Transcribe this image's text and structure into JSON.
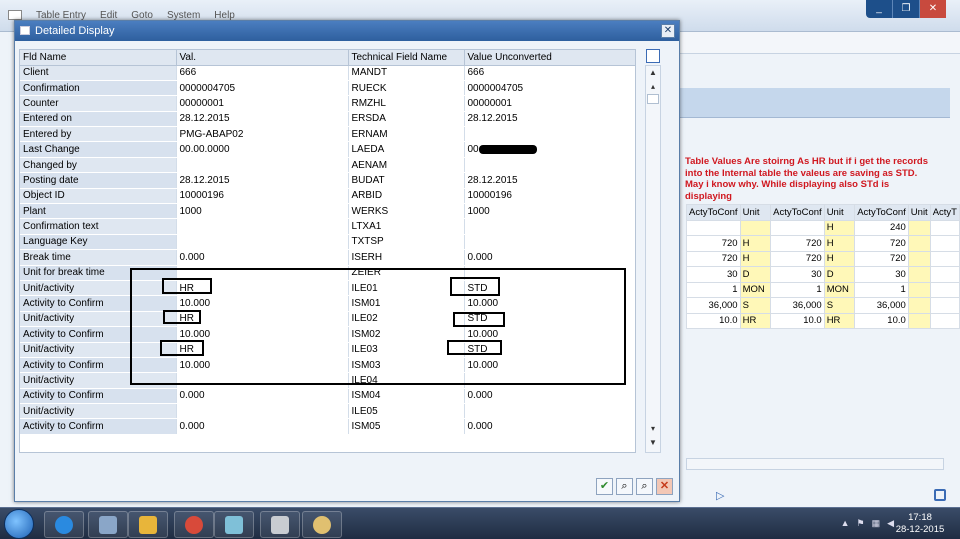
{
  "menubar": {
    "items": [
      "Table Entry",
      "Edit",
      "Goto",
      "System",
      "Help"
    ]
  },
  "window_controls": [
    "_",
    "❐",
    "✕"
  ],
  "dialog": {
    "title": "Detailed Display",
    "close_label": "✕",
    "columns": [
      "Fld Name",
      "Val.",
      "Technical Field Name",
      "Value Unconverted"
    ],
    "rows": [
      {
        "name": "Client",
        "val": "666",
        "tech": "MANDT",
        "unc": "666"
      },
      {
        "name": "Confirmation",
        "val": "0000004705",
        "tech": "RUECK",
        "unc": "0000004705"
      },
      {
        "name": "Counter",
        "val": "00000001",
        "tech": "RMZHL",
        "unc": "00000001"
      },
      {
        "name": "Entered on",
        "val": "28.12.2015",
        "tech": "ERSDA",
        "unc": "28.12.2015"
      },
      {
        "name": "Entered by",
        "val": "PMG-ABAP02",
        "tech": "ERNAM",
        "unc": ""
      },
      {
        "name": "Last Change",
        "val": "00.00.0000",
        "tech": "LAEDA",
        "unc": "00.00.0000"
      },
      {
        "name": "Changed by",
        "val": "",
        "tech": "AENAM",
        "unc": ""
      },
      {
        "name": "Posting date",
        "val": "28.12.2015",
        "tech": "BUDAT",
        "unc": "28.12.2015"
      },
      {
        "name": "Object ID",
        "val": "10000196",
        "tech": "ARBID",
        "unc": "10000196"
      },
      {
        "name": "Plant",
        "val": "1000",
        "tech": "WERKS",
        "unc": "1000"
      },
      {
        "name": "Confirmation text",
        "val": "",
        "tech": "LTXA1",
        "unc": ""
      },
      {
        "name": "Language Key",
        "val": "",
        "tech": "TXTSP",
        "unc": ""
      },
      {
        "name": "Break time",
        "val": "0.000",
        "tech": "ISERH",
        "unc": "0.000"
      },
      {
        "name": "Unit for break time",
        "val": "",
        "tech": "ZEIER",
        "unc": ""
      },
      {
        "name": "Unit/activity",
        "val": "HR",
        "tech": "ILE01",
        "unc": "STD"
      },
      {
        "name": "Activity to Confirm",
        "val": "10.000",
        "tech": "ISM01",
        "unc": "10.000"
      },
      {
        "name": "Unit/activity",
        "val": "HR",
        "tech": "ILE02",
        "unc": "STD"
      },
      {
        "name": "Activity to Confirm",
        "val": "10.000",
        "tech": "ISM02",
        "unc": "10.000"
      },
      {
        "name": "Unit/activity",
        "val": "HR",
        "tech": "ILE03",
        "unc": "STD"
      },
      {
        "name": "Activity to Confirm",
        "val": "10.000",
        "tech": "ISM03",
        "unc": "10.000"
      },
      {
        "name": "Unit/activity",
        "val": "",
        "tech": "ILE04",
        "unc": ""
      },
      {
        "name": "Activity to Confirm",
        "val": "0.000",
        "tech": "ISM04",
        "unc": "0.000"
      },
      {
        "name": "Unit/activity",
        "val": "",
        "tech": "ILE05",
        "unc": ""
      },
      {
        "name": "Activity to Confirm",
        "val": "0.000",
        "tech": "ISM05",
        "unc": "0.000"
      }
    ]
  },
  "annotation_text": "Table Values Are stoirng As HR but if i get the records into the Internal table the valeus are saving as STD. May i know why. While displaying also STd is displaying",
  "alv": {
    "headers": [
      "ActyToConf",
      "Unit",
      "ActyToConf",
      "Unit",
      "ActyToConf",
      "Unit",
      "ActyT"
    ],
    "rows": [
      [
        "",
        "",
        "",
        "H",
        "240",
        "",
        ""
      ],
      [
        "720",
        "H",
        "720",
        "H",
        "720",
        "",
        ""
      ],
      [
        "720",
        "H",
        "720",
        "H",
        "720",
        "",
        ""
      ],
      [
        "30",
        "D",
        "30",
        "D",
        "30",
        "",
        ""
      ],
      [
        "1",
        "MON",
        "1",
        "MON",
        "1",
        "",
        ""
      ],
      [
        "36,000",
        "S",
        "36,000",
        "S",
        "36,000",
        "",
        ""
      ],
      [
        "10.0",
        "HR",
        "10.0",
        "HR",
        "10.0",
        "",
        ""
      ]
    ]
  },
  "clock": {
    "time": "17:18",
    "date": "28-12-2015"
  },
  "colors": {
    "annotation": "#d01820",
    "title_bar": "#2e5f9e",
    "alv_unit": "#fff8b8"
  }
}
